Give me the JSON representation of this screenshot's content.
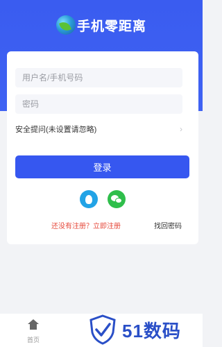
{
  "app": {
    "title": "手机零距离"
  },
  "login_form": {
    "username_placeholder": "用户名/手机号码",
    "password_placeholder": "密码",
    "security_question": "安全提问(未设置请忽略)",
    "login_label": "登录",
    "social": [
      "qq-icon",
      "wechat-icon"
    ],
    "register_link": "还没有注册？立即注册",
    "forgot_link": "找回密码"
  },
  "tabbar": {
    "home_label": "首页"
  },
  "watermark": {
    "text": "51数码"
  },
  "colors": {
    "primary": "#3657f0",
    "header": "#3f62f3",
    "register": "#e64a3c",
    "qq": "#22a3e6",
    "wechat": "#2fbe4b"
  }
}
